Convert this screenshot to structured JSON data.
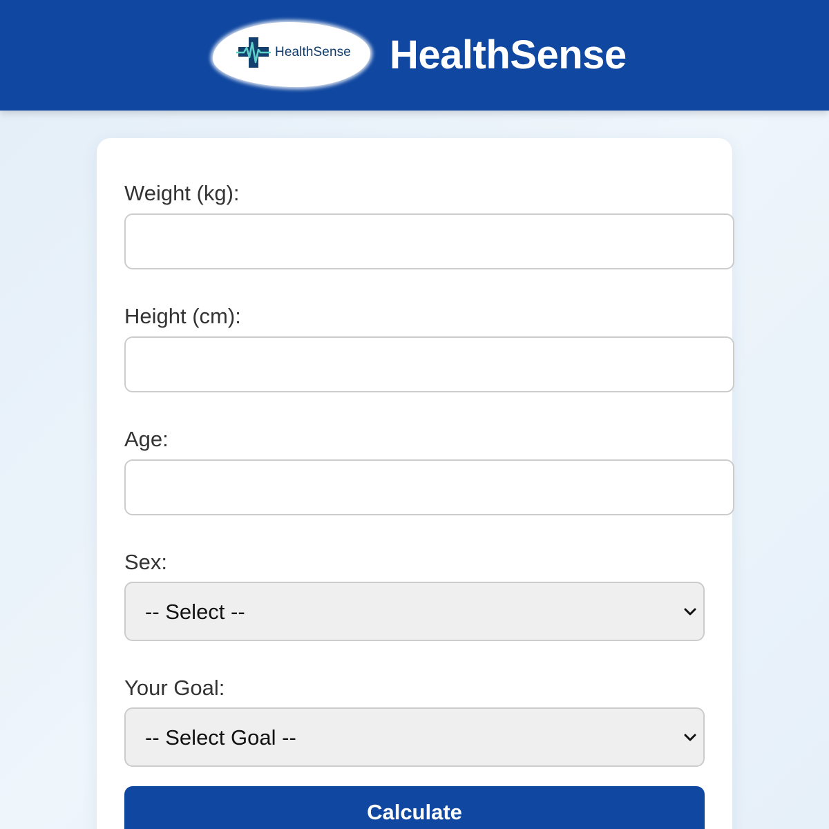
{
  "header": {
    "logo_text": "HealthSense",
    "title": "HealthSense",
    "logo_icon": "medical-cross-heartbeat-icon",
    "background_color": "#0f47a1"
  },
  "form": {
    "weight": {
      "label": "Weight (kg):",
      "value": ""
    },
    "height": {
      "label": "Height (cm):",
      "value": ""
    },
    "age": {
      "label": "Age:",
      "value": ""
    },
    "sex": {
      "label": "Sex:",
      "selected": "-- Select --"
    },
    "goal": {
      "label": "Your Goal:",
      "selected": "-- Select Goal --"
    },
    "submit_label": "Calculate"
  },
  "colors": {
    "primary": "#0f47a1",
    "select_background": "#efefef",
    "input_border": "#cccccc"
  }
}
